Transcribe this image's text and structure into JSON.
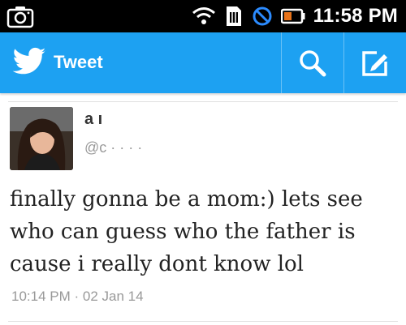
{
  "status_bar": {
    "time": "11:58 PM",
    "icons": [
      "camera-icon",
      "wifi-icon",
      "sim-card-icon",
      "blocked-icon",
      "battery-icon"
    ]
  },
  "header": {
    "title": "Tweet",
    "icons": [
      "twitter-bird-icon",
      "search-icon",
      "compose-icon"
    ],
    "color": "#1da1f2"
  },
  "tweet": {
    "name": "a             ı",
    "handle": "@c  ·  ·  ·  ·",
    "text": "finally gonna be a mom:) lets see who can guess who the father is cause i really dont know lol",
    "timestamp": "10:14 PM · 02 Jan 14"
  }
}
